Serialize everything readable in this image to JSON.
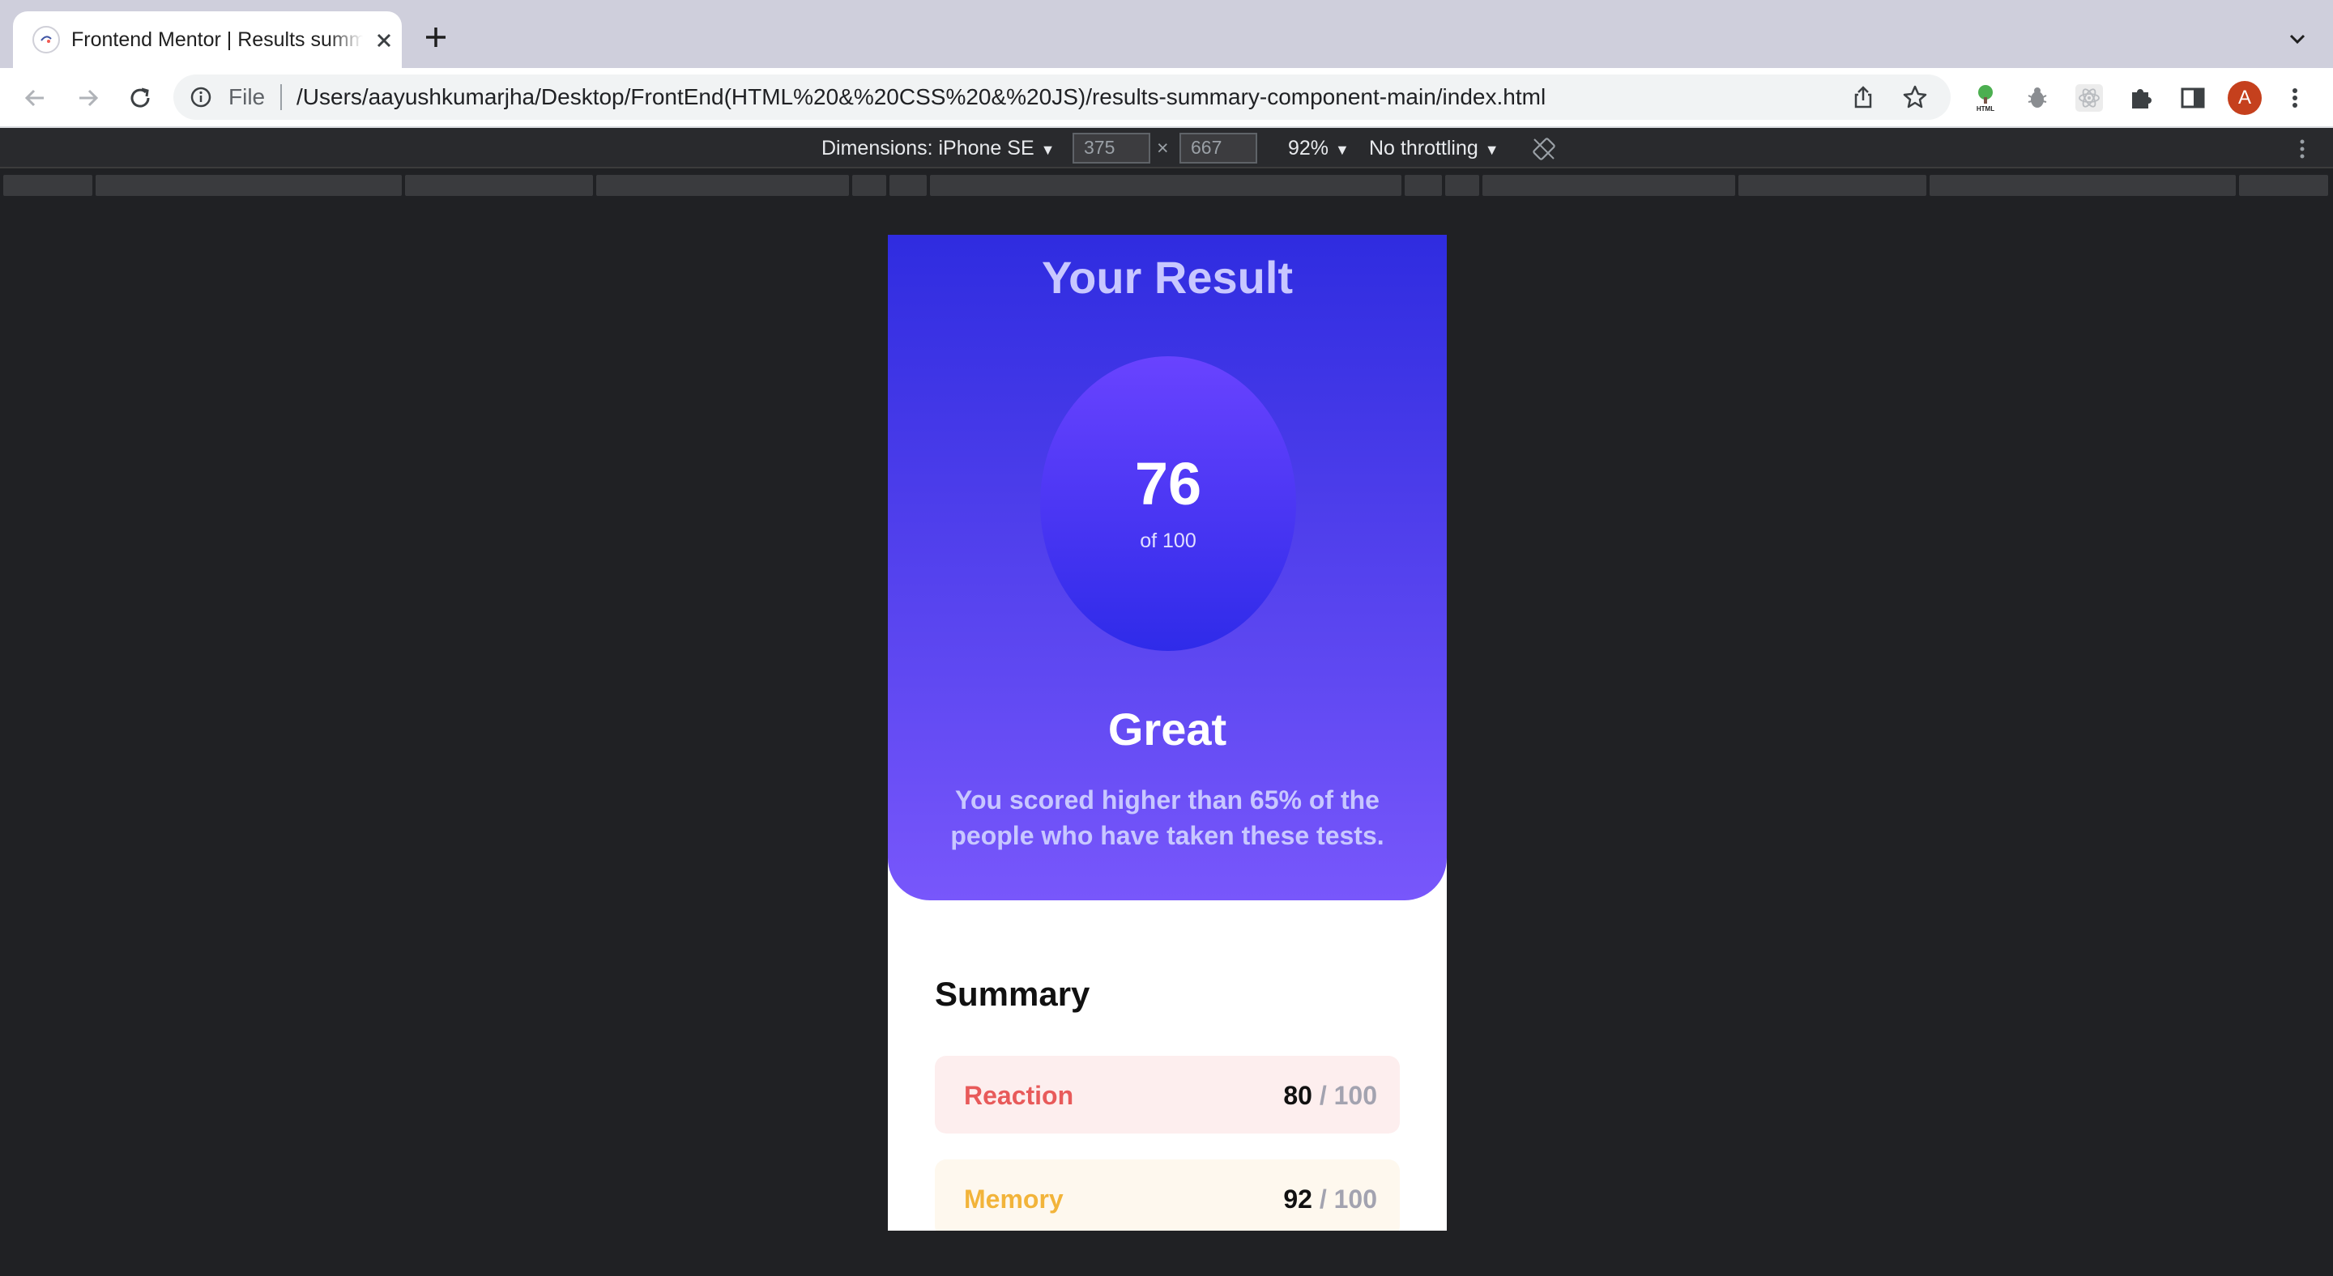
{
  "browser": {
    "tab_title": "Frontend Mentor | Results summary component",
    "omnibox_scheme": "File",
    "url": "/Users/aayushkumarjha/Desktop/FrontEnd(HTML%20&%20CSS%20&%20JS)/results-summary-component-main/index.html",
    "avatar_letter": "A",
    "extensions": [
      "html-tree-icon",
      "bug-icon",
      "react-icon",
      "puzzle-icon",
      "side-panel-icon"
    ]
  },
  "device_toolbar": {
    "dimensions_label": "Dimensions: iPhone SE",
    "width": "375",
    "height": "667",
    "times": "×",
    "zoom": "92%",
    "throttling": "No throttling"
  },
  "page": {
    "result_heading": "Your Result",
    "score": "76",
    "score_of": "of 100",
    "rating": "Great",
    "rating_description": "You scored higher than 65% of the people who have taken these tests.",
    "summary_heading": "Summary",
    "summary_items": [
      {
        "label": "Reaction",
        "value": "80",
        "max": "/ 100",
        "color": "#e85a5a",
        "bg": "#fdeeee"
      },
      {
        "label": "Memory",
        "value": "92",
        "max": "/ 100",
        "color": "#f2b43a",
        "bg": "#fef8ee"
      }
    ],
    "colors": {
      "card_top": "#2f2ce0",
      "card_bottom": "#7857fb",
      "circle_top": "#6943ff",
      "circle_bottom": "#2f2be9"
    }
  }
}
